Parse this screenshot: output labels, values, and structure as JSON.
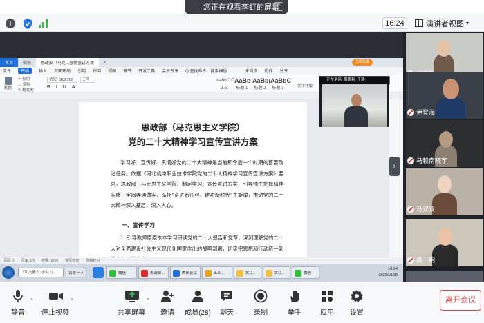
{
  "banner": {
    "text": "您正在观看李虹的屏幕"
  },
  "topbar": {
    "time": "16:24",
    "presenter_view": "演讲者视图"
  },
  "shared": {
    "tabs": [
      "首页",
      "稻壳",
      "思政部（马克...宣传宣讲方案"
    ],
    "login_label": "立即登录",
    "menu": [
      "文件",
      "开始",
      "插入",
      "页面布局",
      "引用",
      "审阅",
      "视图",
      "章节",
      "开发工具",
      "会员专享",
      "Q 查找命令、搜索模板"
    ],
    "ribbon": {
      "paste": "粘贴",
      "cut": "剪切",
      "copy": "复制",
      "format_painter": "格式刷",
      "font": "仿宋_GB2312",
      "size": "三号",
      "styles": [
        {
          "preview": "AaBbCcDd",
          "name": "正文"
        },
        {
          "preview": "AaBb",
          "name": "标题 1"
        },
        {
          "preview": "AaBb(",
          "name": "标题 2"
        },
        {
          "preview": "AaBbC",
          "name": "标题 3"
        }
      ],
      "text_tools": "文字排版",
      "share": "分享",
      "sync": "未同步",
      "collab": "协作"
    },
    "speaker_label": "正在讲话: 周鹏利; 王静;",
    "doc": {
      "title_line1": "思政部（马克思主义学院）",
      "title_line2": "党的二十大精神学习宣传宣讲方案",
      "para1": "学习好、宣传好、贯彻好党的二十大精神是当前和今后一个时期的首要政治任务。依据《河北机电职业技术学院党的二十大精神学习宣传宣讲方案》要求，思政部（马克思主义学院）制定学习、宣传宣讲方案，引导师生把握精神实质，牢固弄通做实，弘扬“奋进新征程、建功新时代”主旋律，推动党的二十大精神深入基层、深入人心。",
      "section1": "一、宣传学习",
      "para2": "1. 引导教师原原本本学习研读党的二十大报告和党章，深刻理解党的二十大对全面建设社会主义现代化国家作出的战略部署，切实把思想和行动统一到党中央精神上来。"
    },
    "statusbar": [
      "页码: 1",
      "页面: 1/3",
      "字数: 1210",
      "拼写检查",
      "文档校对"
    ],
    "taskbar": {
      "search_text": "「和夫要为3岁女儿...",
      "baidu_btn": "百度一下",
      "apps": [
        "微信",
        "思政部...",
        "腾讯会议",
        "五四...",
        "3(1)...",
        "3(1)...",
        "微信"
      ],
      "clock_time": "16:24",
      "clock_date": "2022/10/28"
    }
  },
  "participants": [
    {
      "name": "武再敏"
    },
    {
      "name": "尹登海"
    },
    {
      "name": "马赖南晓宇"
    },
    {
      "name": "马双双"
    },
    {
      "name": "高一明"
    }
  ],
  "toolbar": {
    "unmute": "静音",
    "stop_video": "停止视频",
    "share_screen": "共享屏幕",
    "invite": "邀请",
    "members": "成员(28)",
    "chat": "聊天",
    "record": "录制",
    "raise_hand": "举手",
    "apps": "应用",
    "settings": "设置",
    "leave": "离开会议"
  },
  "colors": {
    "accent": "#1e6fd9",
    "leave": "#e0474c",
    "toolbar_bg": "#f7f8fa",
    "panel_bg": "#1f2228"
  }
}
